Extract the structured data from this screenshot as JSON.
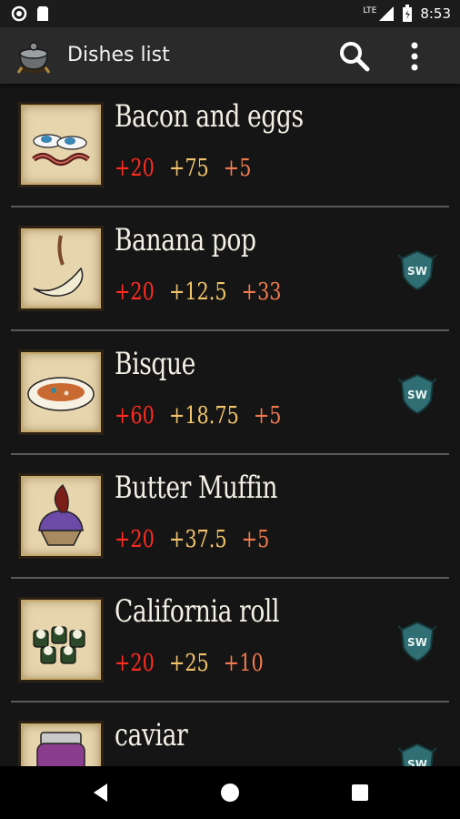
{
  "status_bar": {
    "network": "LTE",
    "time": "8:53"
  },
  "app_bar": {
    "title": "Dishes list"
  },
  "dishes": [
    {
      "name": "Bacon and eggs",
      "hp": "+20",
      "hunger": "+75",
      "sanity": "+5",
      "shipwrecked": false,
      "icon": "bacon-eggs"
    },
    {
      "name": "Banana pop",
      "hp": "+20",
      "hunger": "+12.5",
      "sanity": "+33",
      "shipwrecked": true,
      "badge_text": "SW",
      "icon": "banana-pop"
    },
    {
      "name": "Bisque",
      "hp": "+60",
      "hunger": "+18.75",
      "sanity": "+5",
      "shipwrecked": true,
      "badge_text": "SW",
      "icon": "bisque"
    },
    {
      "name": "Butter Muffin",
      "hp": "+20",
      "hunger": "+37.5",
      "sanity": "+5",
      "shipwrecked": false,
      "icon": "butter-muffin"
    },
    {
      "name": "California roll",
      "hp": "+20",
      "hunger": "+25",
      "sanity": "+10",
      "shipwrecked": true,
      "badge_text": "SW",
      "icon": "california-roll"
    },
    {
      "name": "caviar",
      "shipwrecked": true,
      "badge_text": "SW",
      "icon": "caviar"
    }
  ],
  "colors": {
    "health": "#ff2b20",
    "hunger": "#f1c36b",
    "sanity": "#f07a4f",
    "badge": "#2f6e72"
  }
}
